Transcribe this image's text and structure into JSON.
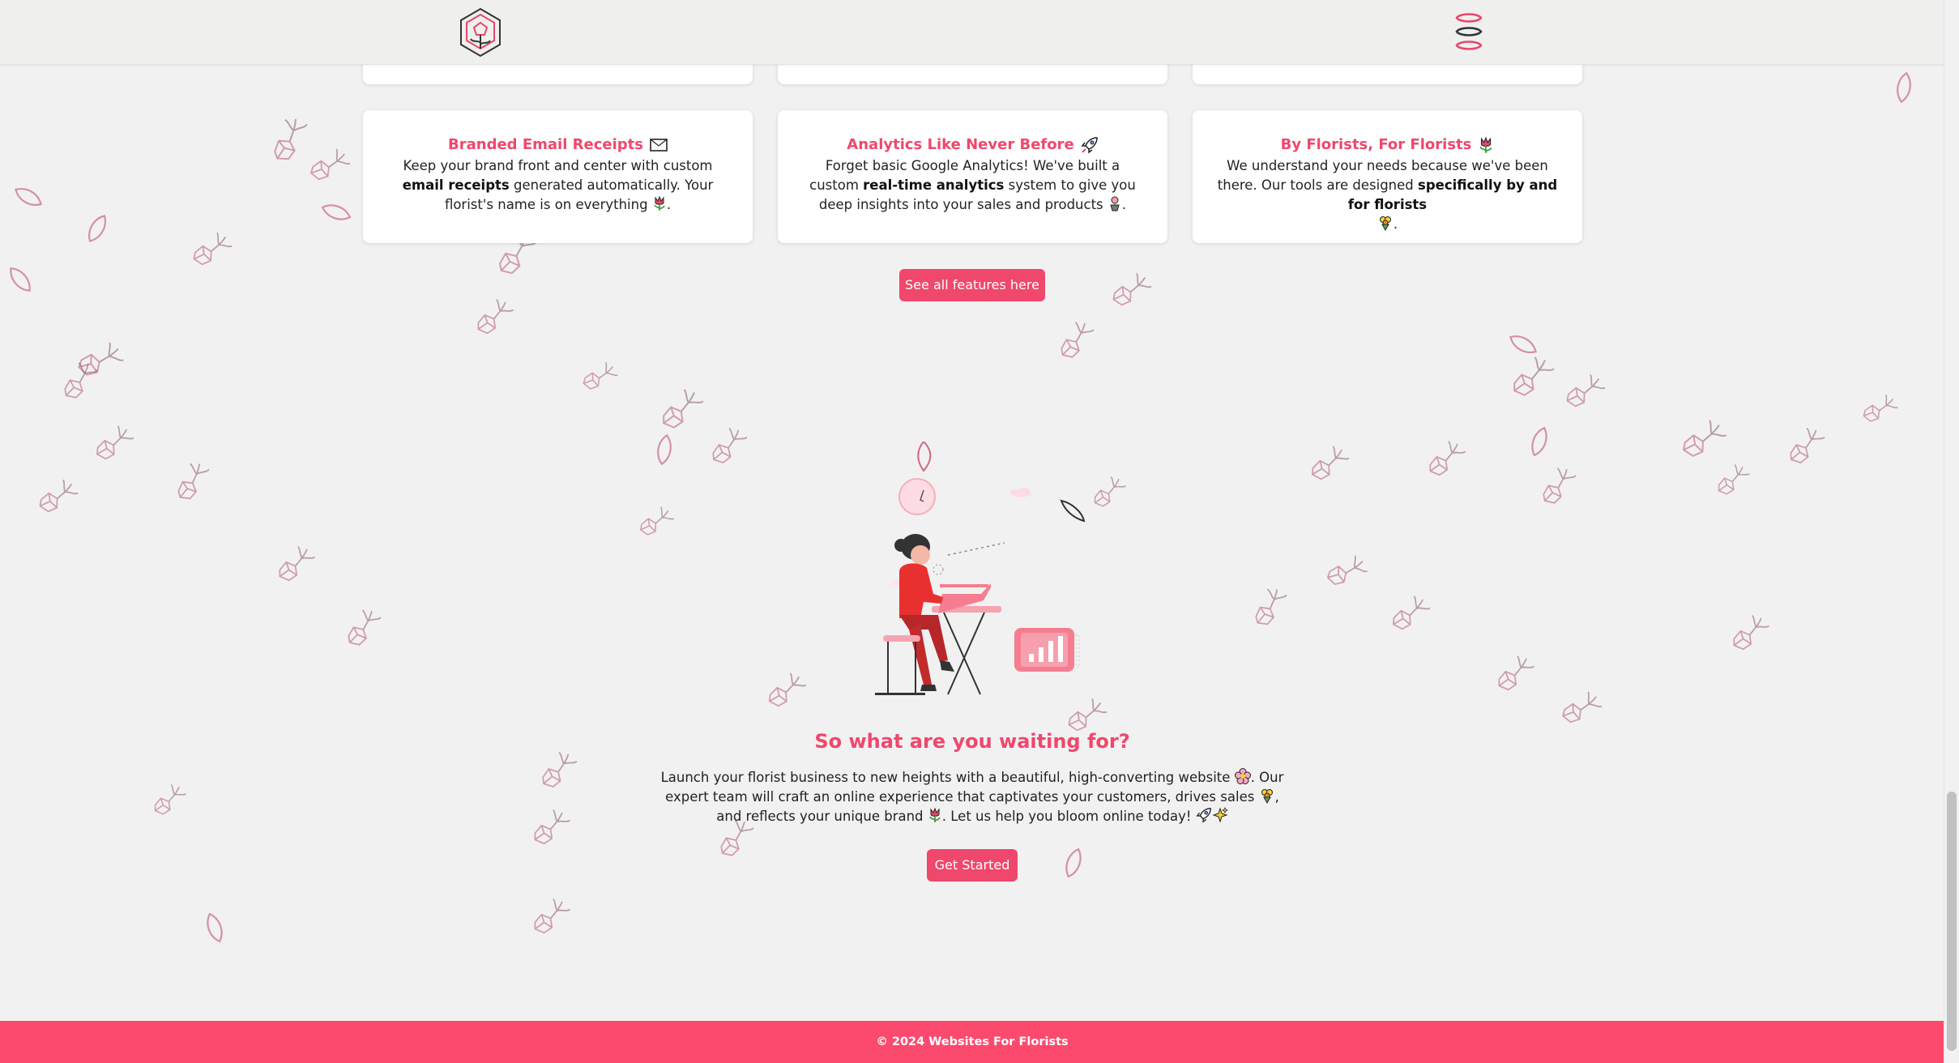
{
  "colors": {
    "accent": "#f0476c",
    "footer": "#fb4a6e",
    "background": "#f2f1f1"
  },
  "header": {
    "logo_icon": "rose-hexagon-logo-icon",
    "menu_icon": "menu-icon"
  },
  "features": [
    {
      "title": "Branded Email Receipts",
      "icon": "envelope-icon",
      "desc_parts": [
        "Keep your brand front and center with custom ",
        "email receipts",
        " generated automatically. Your florist's name is on everything ",
        "."
      ]
    },
    {
      "title": "Analytics Like Never Before",
      "icon": "rocket-icon",
      "desc_parts": [
        "Forget basic Google Analytics! We've built a custom ",
        "real-time analytics",
        " system to give you deep insights into your sales and products ",
        "."
      ]
    },
    {
      "title": "By Florists, For Florists",
      "icon": "tulip-icon",
      "desc_parts": [
        "We understand your needs because we've been there. Our tools are designed ",
        "specifically by and for florists",
        "."
      ]
    }
  ],
  "features_button": "See all features here",
  "cta": {
    "title": "So what are you waiting for?",
    "text_parts": [
      "Launch your florist business to new heights with a beautiful, high-converting website ",
      ". Our expert team will craft an online experience that captivates your customers, drives sales ",
      ", and reflects your unique brand ",
      ". Let us help you bloom online today! "
    ],
    "button": "Get Started"
  },
  "footer": {
    "copyright": "© 2024 Websites For Florists"
  }
}
